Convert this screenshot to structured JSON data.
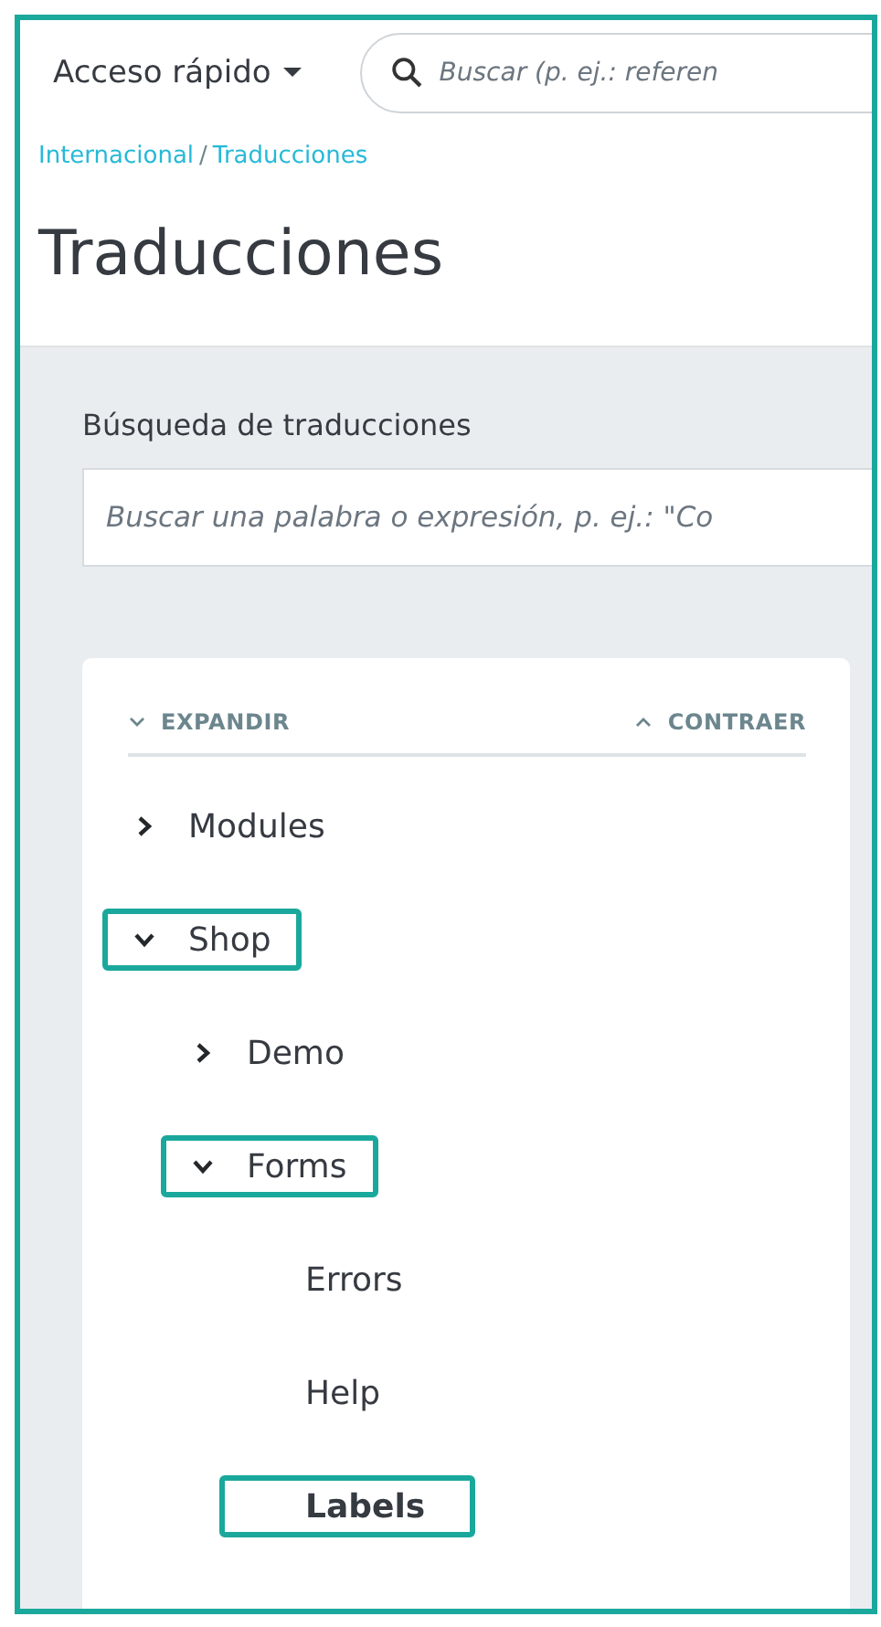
{
  "header": {
    "quick_access": "Acceso rápido",
    "search": {
      "placeholder": "Buscar (p. ej.: referen"
    }
  },
  "breadcrumb": {
    "links": [
      "Internacional",
      "Traducciones"
    ],
    "separator": "/"
  },
  "page_title": "Traducciones",
  "translation_search": {
    "label": "Búsqueda de traducciones",
    "placeholder": "Buscar una palabra o expresión, p. ej.: \"Co"
  },
  "tree_controls": {
    "expand": "EXPANDIR",
    "collapse": "CONTRAER"
  },
  "tree": [
    {
      "label": "Modules",
      "expanded": false,
      "highlighted": false,
      "selected": false
    },
    {
      "label": "Shop",
      "expanded": true,
      "highlighted": true,
      "selected": false,
      "children": [
        {
          "label": "Demo",
          "expanded": false,
          "highlighted": false,
          "selected": false
        },
        {
          "label": "Forms",
          "expanded": true,
          "highlighted": true,
          "selected": false,
          "children": [
            {
              "label": "Errors",
              "highlighted": false,
              "selected": false
            },
            {
              "label": "Help",
              "highlighted": false,
              "selected": false
            },
            {
              "label": "Labels",
              "highlighted": true,
              "selected": true
            }
          ]
        }
      ]
    }
  ]
}
